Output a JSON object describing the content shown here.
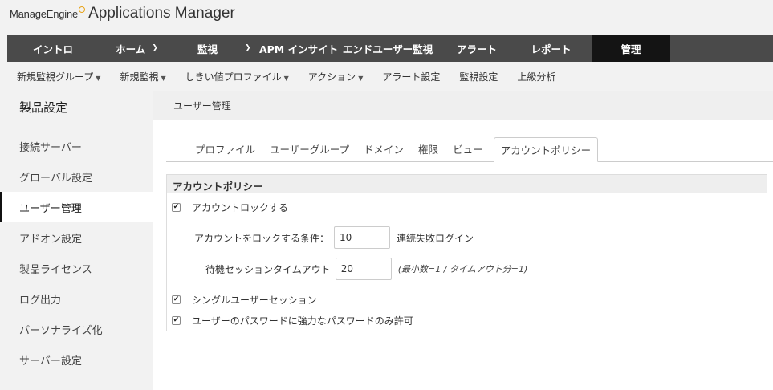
{
  "header": {
    "brand": "ManageEngine",
    "app_title": "Applications Manager"
  },
  "main_nav": {
    "items": [
      {
        "label": "イントロ"
      },
      {
        "label": "ホーム",
        "has_dropdown": true
      },
      {
        "label": "監視",
        "has_dropdown": true
      },
      {
        "label": "APM インサイト"
      },
      {
        "label": "エンドユーザー監視"
      },
      {
        "label": "アラート"
      },
      {
        "label": "レポート"
      },
      {
        "label": "管理",
        "active": true
      }
    ],
    "dropdown_icon": "chevron-down-icon"
  },
  "sub_nav": {
    "items": [
      {
        "label": "新規監視グループ",
        "has_dropdown": true
      },
      {
        "label": "新規監視",
        "has_dropdown": true
      },
      {
        "label": "しきい値プロファイル",
        "has_dropdown": true
      },
      {
        "label": "アクション",
        "has_dropdown": true
      },
      {
        "label": "アラート設定"
      },
      {
        "label": "監視設定"
      },
      {
        "label": "上級分析"
      }
    ]
  },
  "sidebar": {
    "title": "製品設定",
    "items": [
      {
        "label": "接続サーバー"
      },
      {
        "label": "グローバル設定"
      },
      {
        "label": "ユーザー管理",
        "active": true
      },
      {
        "label": "アドオン設定"
      },
      {
        "label": "製品ライセンス"
      },
      {
        "label": "ログ出力"
      },
      {
        "label": "パーソナライズ化"
      },
      {
        "label": "サーバー設定"
      }
    ]
  },
  "content": {
    "header_title": "ユーザー管理",
    "tabs": [
      {
        "label": "プロファイル"
      },
      {
        "label": "ユーザーグループ"
      },
      {
        "label": "ドメイン"
      },
      {
        "label": "権限"
      },
      {
        "label": "ビュー"
      },
      {
        "label": "アカウントポリシー",
        "active": true
      }
    ],
    "panel": {
      "title": "アカウントポリシー",
      "lock_account": {
        "label": "アカウントロックする",
        "checked": true
      },
      "lock_condition": {
        "label": "アカウントをロックする条件：",
        "value": "10",
        "suffix": "連続失敗ログイン"
      },
      "idle_timeout": {
        "label": "待機セッションタイムアウト",
        "value": "20",
        "hint": "(最小数=1 / タイムアウト分=1)"
      },
      "single_session": {
        "label": "シングルユーザーセッション",
        "checked": true
      },
      "strong_password": {
        "label": "ユーザーのパスワードに強力なパスワードのみ許可",
        "checked": true
      }
    }
  }
}
